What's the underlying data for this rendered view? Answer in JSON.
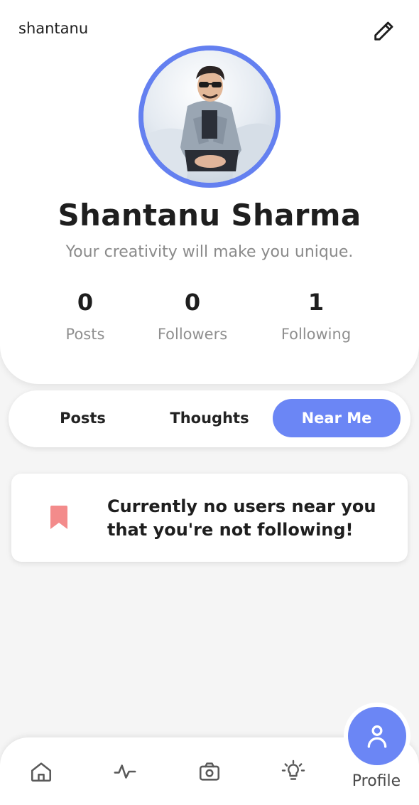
{
  "header": {
    "username": "shantanu",
    "edit_icon": "pencil-icon"
  },
  "profile": {
    "name": "Shantanu Sharma",
    "bio": "Your creativity will make you unique.",
    "avatar_ring_color": "#6480f0"
  },
  "stats": [
    {
      "value": "0",
      "label": "Posts"
    },
    {
      "value": "0",
      "label": "Followers"
    },
    {
      "value": "1",
      "label": "Following"
    }
  ],
  "tabs": [
    {
      "label": "Posts",
      "active": false
    },
    {
      "label": "Thoughts",
      "active": false
    },
    {
      "label": "Near Me",
      "active": true
    }
  ],
  "empty_state": {
    "icon": "bookmark-icon",
    "icon_color": "#f38b8b",
    "message": "Currently no users near you that you're not following!"
  },
  "bottom_nav": {
    "items": [
      {
        "icon": "home-icon"
      },
      {
        "icon": "activity-icon"
      },
      {
        "icon": "camera-icon"
      },
      {
        "icon": "lightbulb-icon"
      }
    ],
    "active": {
      "icon": "profile-icon",
      "label": "Profile"
    },
    "accent_color": "#6b86f5"
  }
}
